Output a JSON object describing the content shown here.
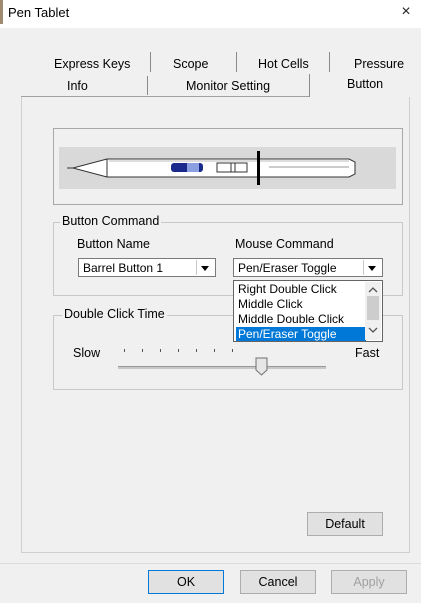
{
  "window": {
    "title": "Pen Tablet",
    "close_glyph": "×"
  },
  "tabs": {
    "row1": [
      "Express Keys",
      "Scope",
      "Hot Cells",
      "Pressure"
    ],
    "row2": [
      "Info",
      "Monitor Setting",
      "Button"
    ],
    "active": "Button"
  },
  "button_command": {
    "group_label": "Button Command",
    "button_name_label": "Button Name",
    "button_name_value": "Barrel Button 1",
    "mouse_command_label": "Mouse Command",
    "mouse_command_value": "Pen/Eraser Toggle",
    "dropdown_options": [
      "Right Double Click",
      "Middle Click",
      "Middle Double Click",
      "Pen/Eraser Toggle"
    ],
    "selected_option": "Pen/Eraser Toggle"
  },
  "double_click": {
    "group_label": "Double Click Time",
    "slow_label": "Slow",
    "fast_label": "Fast",
    "slider_fraction": 0.68
  },
  "buttons": {
    "default": "Default",
    "ok": "OK",
    "cancel": "Cancel",
    "apply": "Apply"
  },
  "colors": {
    "selection": "#0078d7",
    "dialog_bg": "#f0f0f0"
  }
}
